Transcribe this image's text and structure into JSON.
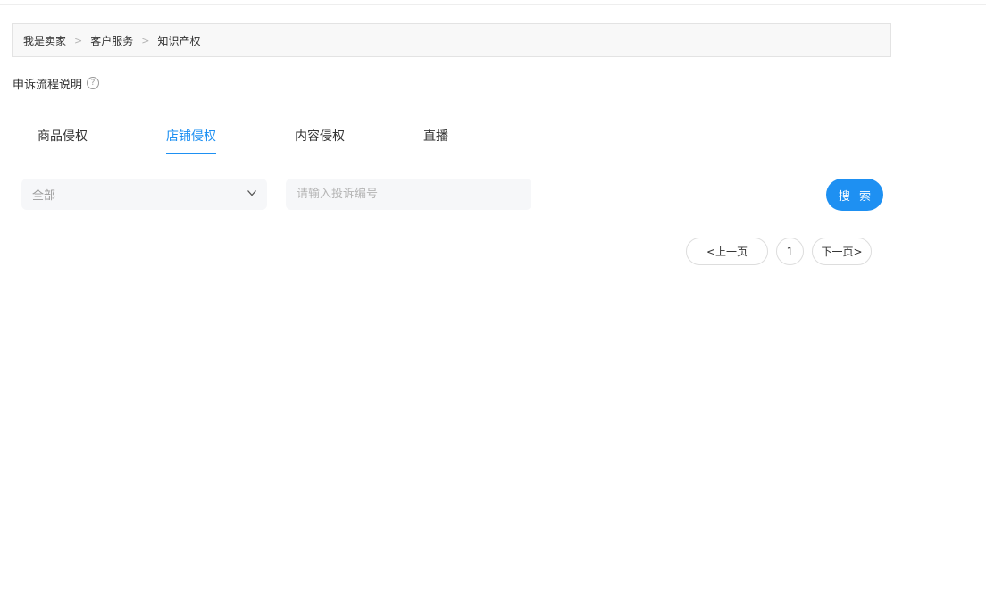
{
  "breadcrumb": {
    "items": [
      "我是卖家",
      "客户服务",
      "知识产权"
    ],
    "separator": ">"
  },
  "help": {
    "label": "申诉流程说明",
    "icon": "question-circle-icon",
    "icon_glyph": "?"
  },
  "tabs": [
    {
      "label": "商品侵权",
      "active": false
    },
    {
      "label": "店铺侵权",
      "active": true
    },
    {
      "label": "内容侵权",
      "active": false
    },
    {
      "label": "直播",
      "active": false
    }
  ],
  "filters": {
    "type_select": {
      "value": "全部",
      "icon": "chevron-down-icon"
    },
    "complaint_number": {
      "value": "",
      "placeholder": "请输入投诉编号"
    },
    "search_label": "搜 索"
  },
  "pagination": {
    "prev_label": "<上一页",
    "current_page": "1",
    "next_label": "下一页>"
  },
  "colors": {
    "accent": "#1e90f2",
    "text": "#333333",
    "placeholder": "#b5b5b5",
    "field_bg": "#f6f7f9"
  }
}
